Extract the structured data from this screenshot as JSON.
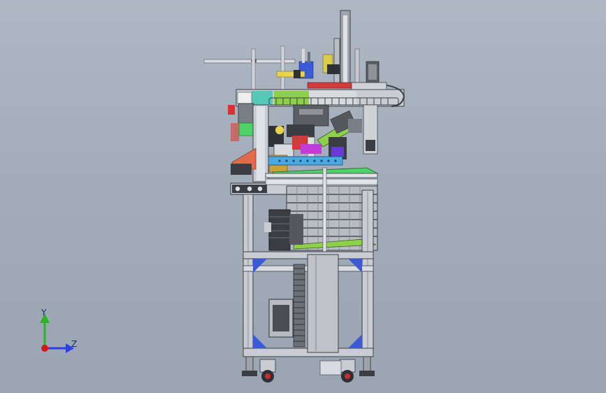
{
  "viewport": {
    "background_top": "#aeb7c3",
    "background_bottom": "#9aa4b2"
  },
  "triad": {
    "y_label": "Y",
    "z_label": "Z",
    "y_color": "#2bb32b",
    "z_color": "#2c3fe0",
    "x_color": "#d81818"
  },
  "model": {
    "icon": "cad-assembly-machine-icon",
    "part_colors": {
      "frame": "#c9ccd2",
      "frame_dark": "#7f858e",
      "accent_green": "#4fd26a",
      "accent_lime": "#8dd04a",
      "accent_teal": "#55c9b8",
      "accent_red": "#d23b3b",
      "accent_yellow": "#e8d34a",
      "accent_blue": "#3a5ad8",
      "accent_magenta": "#c23ad8",
      "motor_dark": "#3b3d42"
    }
  }
}
